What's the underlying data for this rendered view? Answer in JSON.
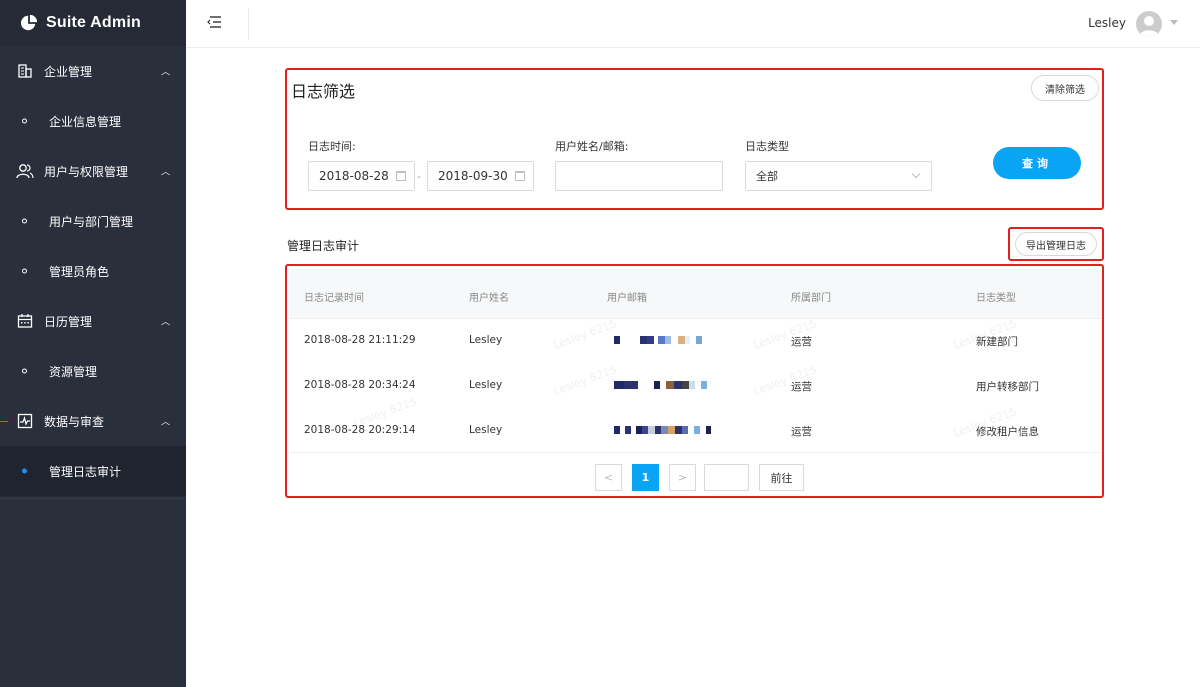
{
  "brand": {
    "title": "Suite Admin"
  },
  "sidebar": {
    "groups": [
      {
        "label": "企业管理",
        "items": [
          {
            "label": "企业信息管理"
          }
        ]
      },
      {
        "label": "用户与权限管理",
        "items": [
          {
            "label": "用户与部门管理"
          },
          {
            "label": "管理员角色"
          }
        ]
      },
      {
        "label": "日历管理",
        "items": [
          {
            "label": "资源管理"
          }
        ]
      },
      {
        "label": "数据与审查",
        "items": [
          {
            "label": "管理日志审计"
          }
        ]
      }
    ],
    "active_item": "管理日志审计"
  },
  "header": {
    "user_name": "Lesley"
  },
  "filter": {
    "title": "日志筛选",
    "clear_label": "清除筛选",
    "date_label": "日志时间:",
    "date_start": "2018-08-28",
    "date_end": "2018-09-30",
    "date_separator": "-",
    "user_label": "用户姓名/邮箱:",
    "user_value": "",
    "type_label": "日志类型",
    "type_value": "全部",
    "query_label": "查询"
  },
  "audit": {
    "title": "管理日志审计",
    "export_label": "导出管理日志",
    "columns": [
      "日志记录时间",
      "用户姓名",
      "用户邮箱",
      "所属部门",
      "日志类型"
    ],
    "rows": [
      {
        "time": "2018-08-28 21:11:29",
        "name": "Lesley",
        "dept": "运营",
        "type": "新建部门"
      },
      {
        "time": "2018-08-28 20:34:24",
        "name": "Lesley",
        "dept": "运营",
        "type": "用户转移部门"
      },
      {
        "time": "2018-08-28 20:29:14",
        "name": "Lesley",
        "dept": "运营",
        "type": "修改租户信息"
      }
    ],
    "watermark": "Lesley 6215"
  },
  "pagination": {
    "prev": "<",
    "current": "1",
    "next": ">",
    "goto_label": "前往",
    "goto_value": ""
  }
}
